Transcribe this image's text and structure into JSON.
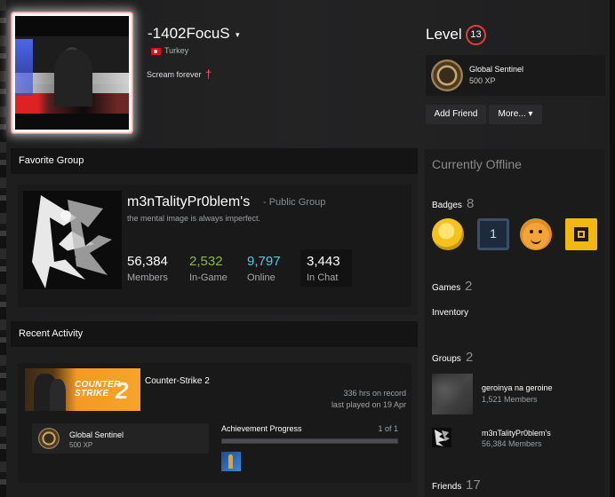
{
  "profile": {
    "persona_name": "-1402FocuS",
    "caret": "▾",
    "country": "Turkey",
    "summary": "Scream forever",
    "summary_symbol": "†"
  },
  "level": {
    "label": "Level",
    "value": "13",
    "ring_color": "#e53d3d"
  },
  "featured_badge": {
    "title": "Global Sentinel",
    "xp": "500 XP"
  },
  "actions": {
    "add_friend": "Add Friend",
    "more": "More... ▾"
  },
  "favorite_group": {
    "section_title": "Favorite Group",
    "name": "m3nTalityPr0blem's",
    "type": "- Public Group",
    "headline": "the mental image is always imperfect.",
    "stats": [
      {
        "value": "56,384",
        "label": "Members",
        "color": "#ffffff"
      },
      {
        "value": "2,532",
        "label": "In-Game",
        "color": "#90ba3c"
      },
      {
        "value": "9,797",
        "label": "Online",
        "color": "#57cbde"
      },
      {
        "value": "3,443",
        "label": "In Chat",
        "color": "#ffffff"
      }
    ]
  },
  "recent_activity": {
    "section_title": "Recent Activity",
    "game": {
      "name": "Counter-Strike 2",
      "capsule_text_1": "COUNTER",
      "capsule_text_2": "STRIKE",
      "capsule_number": "2",
      "hours": "336 hrs on record",
      "last_played": "last played on 19 Apr",
      "badge_title": "Global Sentinel",
      "badge_xp": "500 XP",
      "achievement_label": "Achievement Progress",
      "achievement_count": "1 of 1",
      "achievement_progress": 1.0
    }
  },
  "sidebar": {
    "status": "Currently Offline",
    "badges_label": "Badges",
    "badges_count": "8",
    "badge_one_text": "1",
    "games_label": "Games",
    "games_count": "2",
    "inventory_label": "Inventory",
    "groups_label": "Groups",
    "groups_count": "2",
    "groups": [
      {
        "name": "geroinya na geroine",
        "members": "1,521 Members"
      },
      {
        "name": "m3nTalityPr0blem's",
        "members": "56,384 Members"
      }
    ],
    "friends_label": "Friends",
    "friends_count": "17"
  }
}
